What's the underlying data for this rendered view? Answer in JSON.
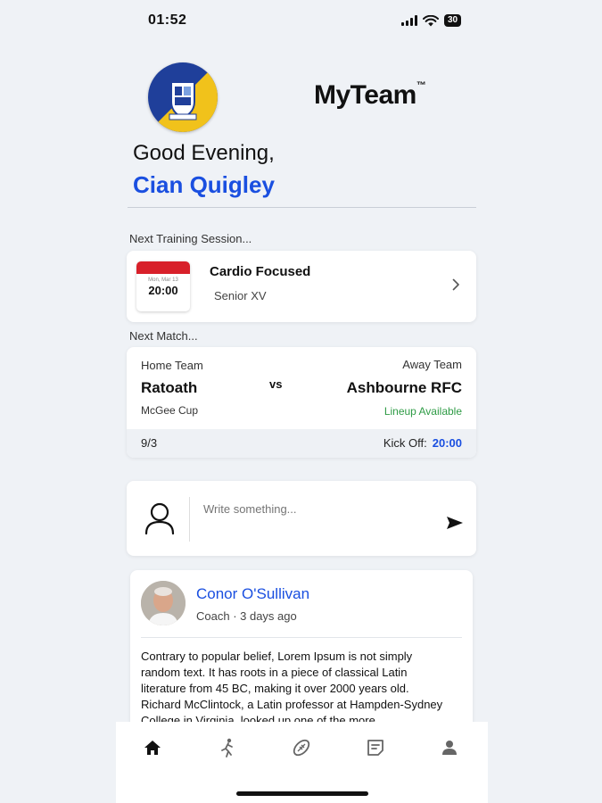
{
  "status_bar": {
    "time": "01:52",
    "battery": "30"
  },
  "header": {
    "brand": "MyTeam",
    "brand_mark": "™",
    "greeting": "Good Evening,",
    "user_name": "Cian Quigley",
    "logo_colors": [
      "#1f3f9a",
      "#f1c21b"
    ]
  },
  "training": {
    "section_label": "Next Training Session...",
    "calendar_date": "Mon, Mar 13",
    "calendar_time": "20:00",
    "title": "Cardio Focused",
    "subtitle": "Senior XV",
    "accent_color": "#d8202a"
  },
  "match": {
    "section_label": "Next Match...",
    "home_label": "Home Team",
    "home_team": "Ratoath",
    "competition": "McGee Cup",
    "vs": "vs",
    "away_label": "Away Team",
    "away_team": "Ashbourne RFC",
    "lineup_status": "Lineup Available",
    "date": "9/3",
    "kickoff_label": "Kick Off:",
    "kickoff_time": "20:00"
  },
  "composer": {
    "placeholder": "Write something..."
  },
  "post": {
    "author": "Conor O'Sullivan",
    "meta": "Coach · 3 days ago",
    "body": "Contrary to popular belief, Lorem Ipsum is not simply random text. It has roots in a piece of classical Latin literature from 45 BC, making it over 2000 years old. Richard McClintock, a Latin professor at Hampden-Sydney College in Virginia, looked up one of the more"
  },
  "tabbar": {
    "items": [
      "home-icon",
      "running-player-icon",
      "rugby-ball-icon",
      "notes-icon",
      "profile-icon"
    ],
    "active_index": 0
  },
  "colors": {
    "accent": "#1a4fe0",
    "success": "#2e9b45",
    "background": "#eff2f6"
  }
}
